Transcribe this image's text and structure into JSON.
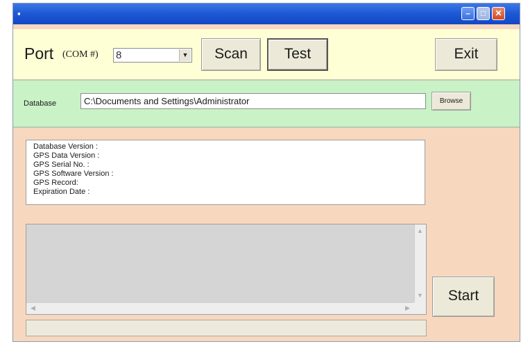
{
  "window": {
    "title": "",
    "app_icon": "app-icon",
    "controls": {
      "minimize": "minimize-icon",
      "maximize": "maximize-icon",
      "close": "close-icon"
    }
  },
  "port": {
    "label": "Port",
    "com_label": "(COM #)",
    "selected": "8",
    "scan_label": "Scan",
    "test_label": "Test",
    "exit_label": "Exit"
  },
  "database": {
    "label": "Database",
    "path": "C:\\Documents and Settings\\Administrator",
    "browse_label": "Browse"
  },
  "info": {
    "lines": [
      "Database Version :",
      "GPS Data Version :",
      "GPS Serial No. :",
      "GPS Software Version :",
      "GPS Record:",
      "Expiration Date :"
    ]
  },
  "actions": {
    "start_label": "Start"
  },
  "colors": {
    "window_bg": "#f7d8bf",
    "port_panel": "#ffffd6",
    "database_panel": "#c9f2c7",
    "titlebar": "#1f5ad6"
  }
}
